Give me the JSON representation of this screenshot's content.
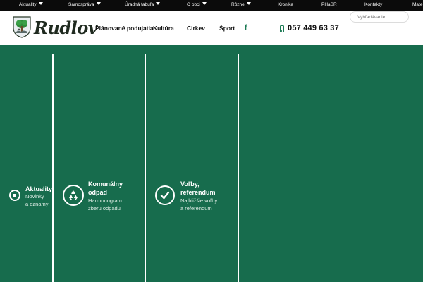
{
  "topbar": {
    "items": [
      {
        "label": "Aktuality",
        "dropdown": true
      },
      {
        "label": "Samospráva",
        "dropdown": true
      },
      {
        "label": "Úradná tabuľa",
        "dropdown": true
      },
      {
        "label": "O obci",
        "dropdown": true
      },
      {
        "label": "Rôzne",
        "dropdown": true
      },
      {
        "label": "Kronika",
        "dropdown": false
      },
      {
        "label": "PHaSR",
        "dropdown": false
      },
      {
        "label": "Kontakty",
        "dropdown": false
      },
      {
        "label": "Mate",
        "dropdown": false
      }
    ]
  },
  "search": {
    "placeholder": "Vyhľadávanie"
  },
  "header": {
    "brand": "Rudlov",
    "nav": [
      "Plánované podujatia",
      "Kultúra",
      "Cirkev",
      "Šport"
    ],
    "facebook_icon": "f",
    "phone": "057 449 63 37"
  },
  "tiles": [
    {
      "title": "Aktuality",
      "desc": [
        "Novinky",
        "a oznamy"
      ],
      "icon": "news-icon"
    },
    {
      "title": [
        "Komunálny",
        "odpad"
      ],
      "desc": [
        "Harmonogram",
        "zberu odpadu"
      ],
      "icon": "recycle-icon"
    },
    {
      "title": [
        "Voľby,",
        "referendum"
      ],
      "desc": [
        "Najbližšie voľby",
        "a referendum"
      ],
      "icon": "check-icon"
    }
  ],
  "colors": {
    "brand_green": "#176c4d",
    "topbar": "#0b0b0b",
    "accent_green": "#1c7a54"
  }
}
